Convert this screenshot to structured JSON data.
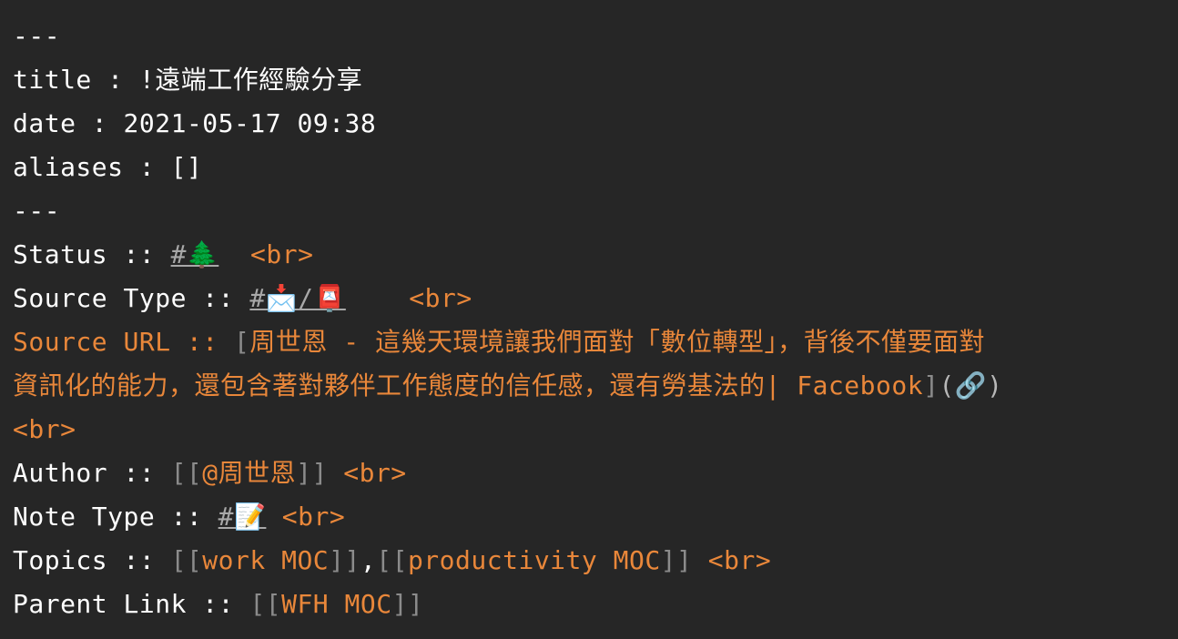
{
  "frontmatter": {
    "open": "---",
    "title_key": "title : ",
    "title_value": "!遠端工作經驗分享",
    "date_key": "date : ",
    "date_value": "2021-05-17 09:38",
    "aliases_key": "aliases : ",
    "aliases_value": "[]",
    "close": "---"
  },
  "br": "<br>",
  "status": {
    "key": "Status :: ",
    "tag": "#🌲"
  },
  "source_type": {
    "key": "Source Type :: ",
    "tag": "#📩/📮"
  },
  "source_url": {
    "key": "Source URL :: ",
    "open_bracket": "[",
    "text_line1": "周世恩 - 這幾天環境讓我們面對「數位轉型」，背後不僅要面對",
    "text_line2": "資訊化的能力，還包含著對夥伴工作態度的信任感，還有勞基法的| Facebook",
    "close_bracket": "]",
    "link_paren": "(🔗)"
  },
  "author": {
    "key": "Author :: ",
    "open": "[[",
    "value": "@周世恩",
    "close": "]]"
  },
  "note_type": {
    "key": "Note Type :: ",
    "tag": "#📝"
  },
  "topics": {
    "key": "Topics :: ",
    "open1": "[[",
    "value1": "work MOC",
    "close1": "]]",
    "sep": ",",
    "open2": "[[",
    "value2": "productivity MOC",
    "close2": "]]"
  },
  "parent_link": {
    "key": "Parent Link :: ",
    "open": "[[",
    "value": "WFH MOC",
    "close": "]]"
  }
}
